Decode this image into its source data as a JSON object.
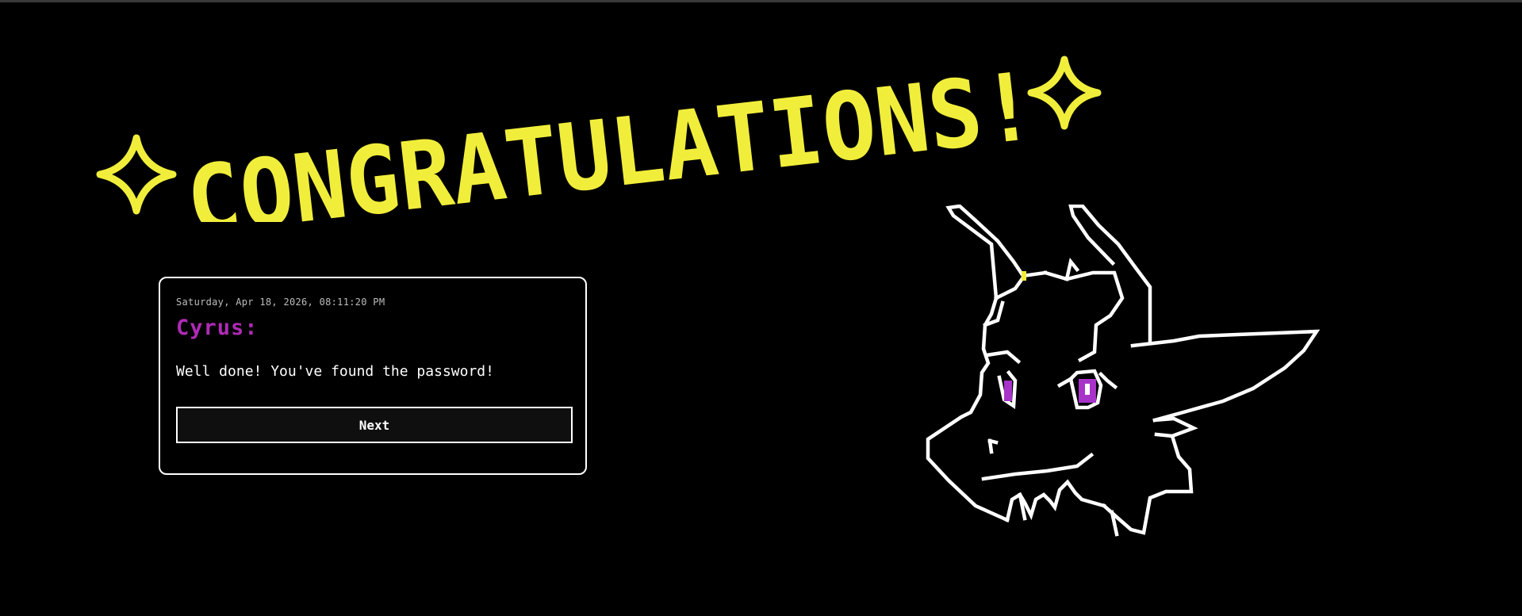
{
  "title": {
    "text": "CONGRATULATIONS!",
    "color": "#f1ee3b",
    "sparkle_icon": "four-point-star"
  },
  "dialog": {
    "timestamp": "Saturday, Apr 18, 2026, 08:11:20 PM",
    "speaker": "Cyrus:",
    "speaker_color": "#b02ab7",
    "message": "Well done! You've found the password!",
    "next_label": "Next"
  },
  "illustration": {
    "subject": "pixel-dragon-head",
    "line_color": "#ffffff",
    "eye_color": "#a733c9"
  }
}
